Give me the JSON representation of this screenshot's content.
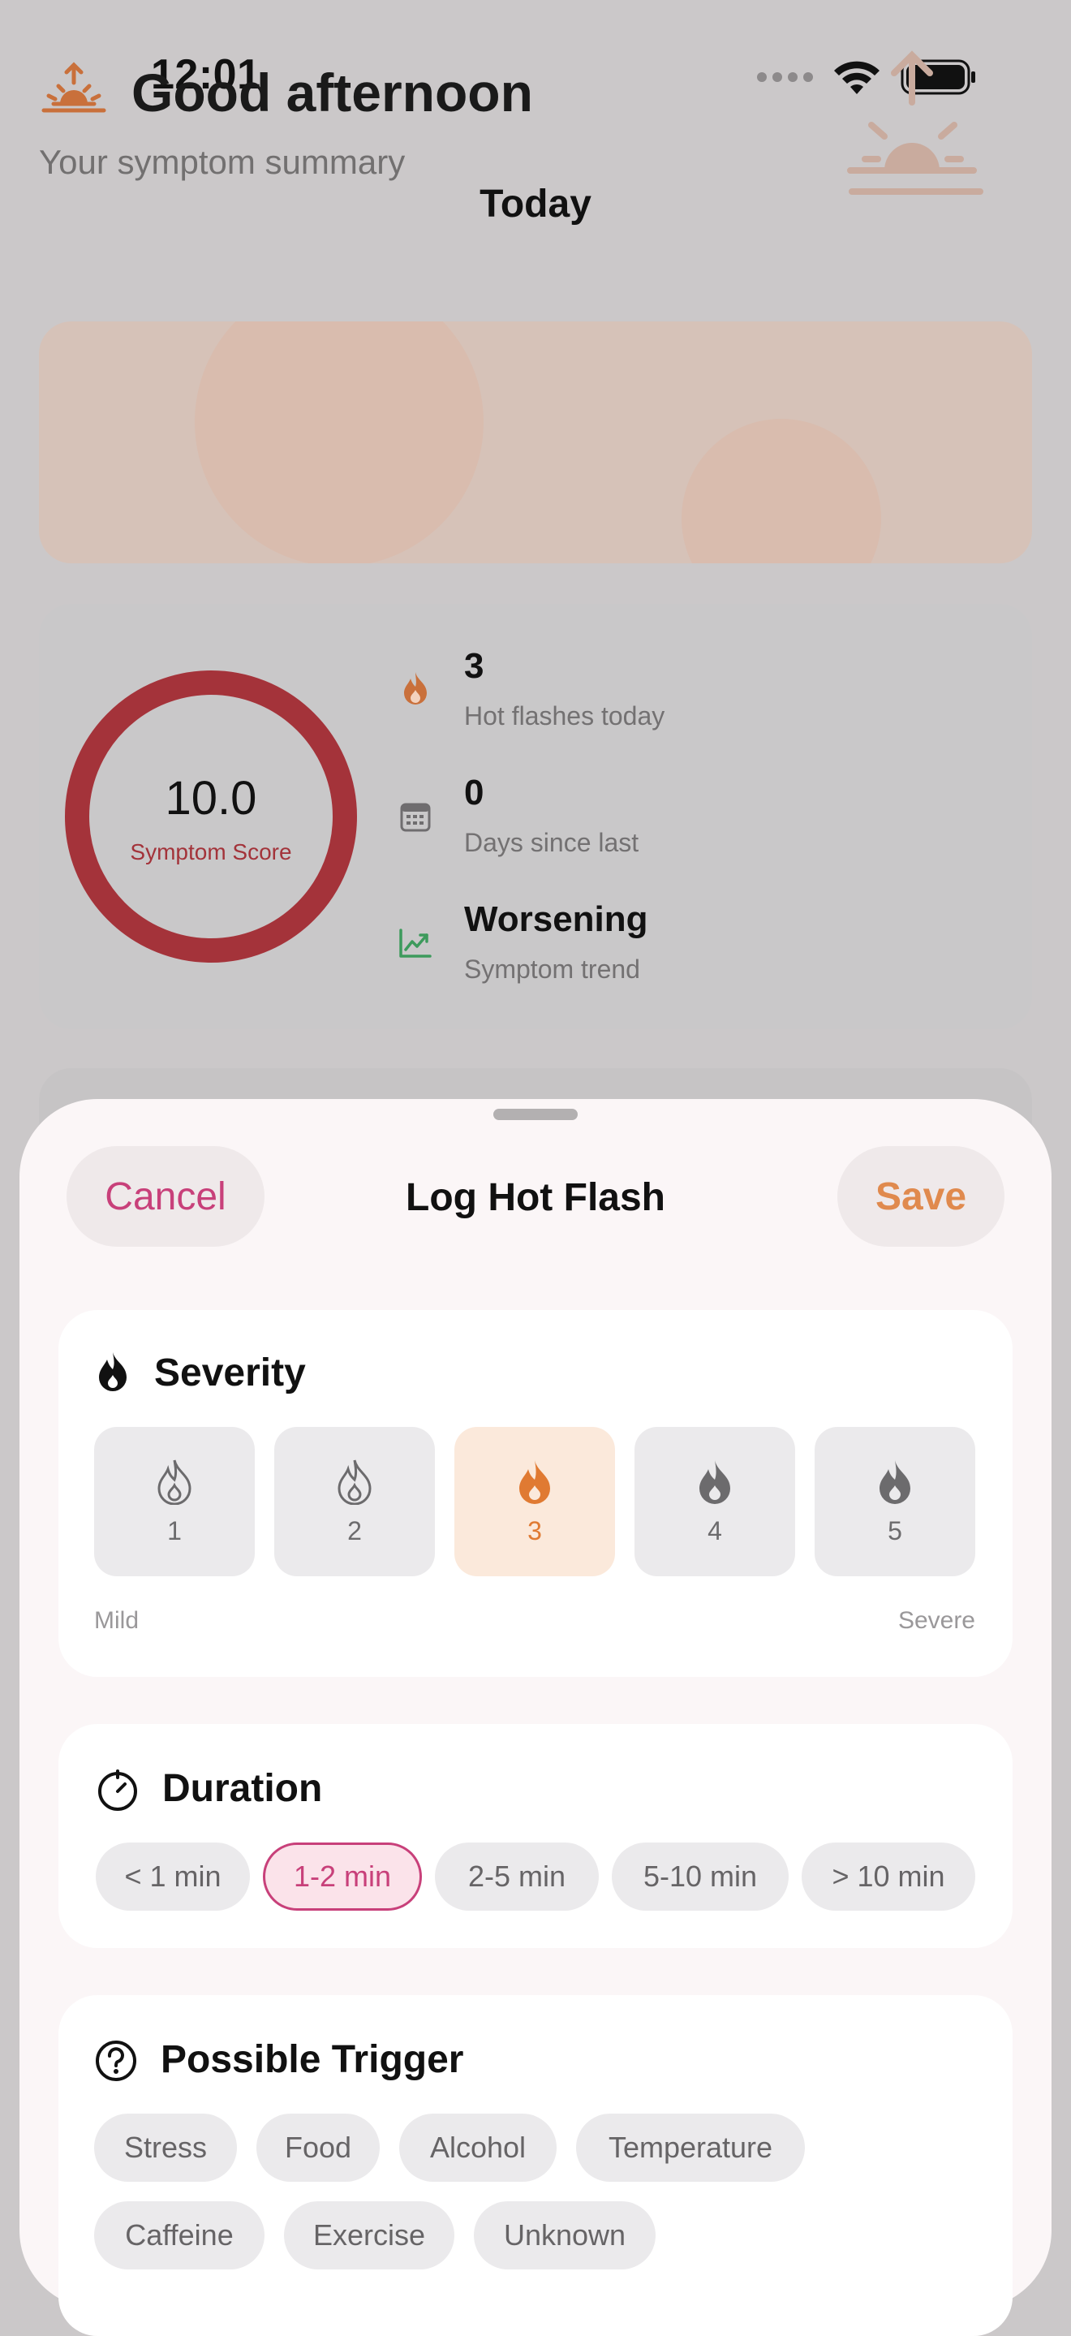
{
  "status": {
    "time": "12:01"
  },
  "nav": {
    "title": "Today"
  },
  "greeting": {
    "title": "Good afternoon",
    "subtitle": "Your symptom summary"
  },
  "summary": {
    "score_value": "10.0",
    "score_label": "Symptom Score",
    "score_fraction": 1.0,
    "ring_color": "#a4333a",
    "stats": [
      {
        "value": "3",
        "label": "Hot flashes today",
        "icon": "flame-icon"
      },
      {
        "value": "0",
        "label": "Days since last",
        "icon": "calendar-icon"
      },
      {
        "value": "Worsening",
        "label": "Symptom trend",
        "icon": "trend-up-icon"
      }
    ]
  },
  "sheet": {
    "cancel_label": "Cancel",
    "save_label": "Save",
    "title": "Log Hot Flash",
    "severity": {
      "title": "Severity",
      "levels": [
        "1",
        "2",
        "3",
        "4",
        "5"
      ],
      "selected": "3",
      "min_label": "Mild",
      "max_label": "Severe"
    },
    "duration": {
      "title": "Duration",
      "options": [
        "< 1 min",
        "1-2 min",
        "2-5 min",
        "5-10 min",
        "> 10 min"
      ],
      "selected": "1-2 min"
    },
    "trigger": {
      "title": "Possible Trigger",
      "options": [
        "Stress",
        "Food",
        "Alcohol",
        "Temperature",
        "Caffeine",
        "Exercise",
        "Unknown"
      ]
    }
  },
  "colors": {
    "accent_pink": "#c8407a",
    "accent_orange": "#e08a4e",
    "score_red": "#a4333a"
  }
}
